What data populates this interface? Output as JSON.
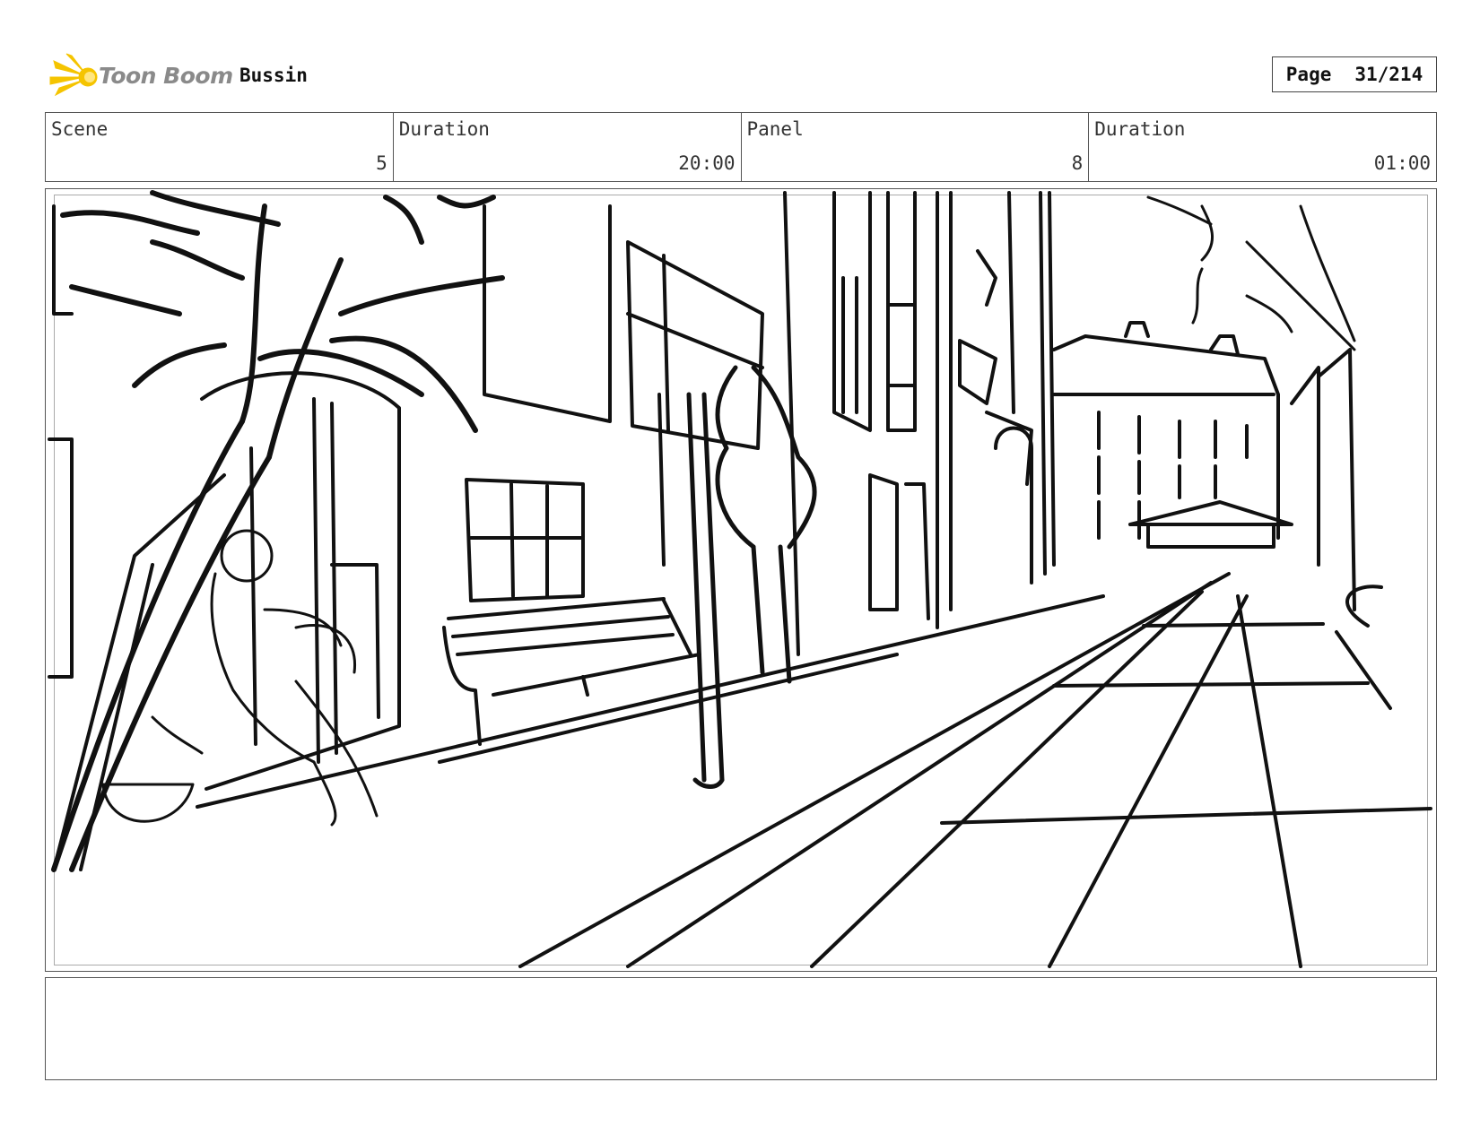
{
  "header": {
    "logo_text": "Toon Boom",
    "project_name": "Bussin",
    "page_label": "Page",
    "page_value": "31/214"
  },
  "info": {
    "scene_label": "Scene",
    "scene_value": "5",
    "scene_duration_label": "Duration",
    "scene_duration_value": "20:00",
    "panel_label": "Panel",
    "panel_value": "8",
    "panel_duration_label": "Duration",
    "panel_duration_value": "01:00"
  },
  "panel": {
    "image_description": "sketch-street-scene"
  },
  "notes": {
    "text": ""
  }
}
